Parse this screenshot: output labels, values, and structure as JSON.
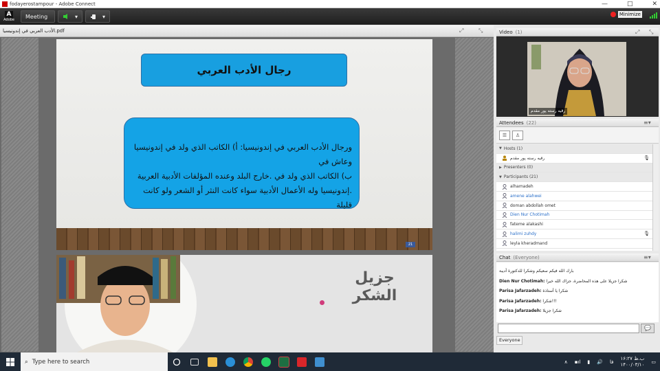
{
  "window": {
    "title": "fodayerostampour - Adobe Connect",
    "controls": [
      "—",
      "□",
      "✕"
    ]
  },
  "toolbar": {
    "logo_text": "Adobe",
    "meeting_label": "Meeting",
    "record_label": "Minimize"
  },
  "share_pod": {
    "file_name": "الأدب العربي في إندونيسيا.pdf",
    "slide1": {
      "title": "رجال الأدب العربي",
      "body_lines": [
        "ورجال الأدب العربي في إندونيسيا: أ) الكاتب الذي ولد في إندونيسيا وعاش في",
        "ب) الكاتب الذي ولد في .خارج البلد وعنده المؤلفات الأدبية العربية",
        ".إندونيسيا وله الأعمال الأدبية سواء كانت النثر أو الشعر ولو كانت قليلة"
      ],
      "page_badge": "21"
    },
    "slide2": {
      "thanks_line1": "جزيل",
      "thanks_line2": "الشكر"
    }
  },
  "video_pod": {
    "title": "Video",
    "count": "(1)",
    "speaker_name": "رقیه رسته پور مقدم"
  },
  "attendees_pod": {
    "title": "Attendees",
    "count": "(22)",
    "groups": {
      "hosts": "Hosts (1)",
      "presenters": "Presenters (0)",
      "participants": "Participants (21)"
    },
    "host_name": "رقیه رسته پور مقدم",
    "participants": [
      {
        "name": "alhamadeh",
        "blue": false,
        "mic": false
      },
      {
        "name": "amene alahwei",
        "blue": true,
        "mic": false
      },
      {
        "name": "doman abdollah omet",
        "blue": false,
        "mic": false
      },
      {
        "name": "Dien Nur Chotimah",
        "blue": true,
        "mic": false
      },
      {
        "name": "fateme alakashi",
        "blue": false,
        "mic": false
      },
      {
        "name": "halimi zuhdy",
        "blue": true,
        "mic": true
      },
      {
        "name": "leyla kheradmand",
        "blue": false,
        "mic": false
      }
    ]
  },
  "chat_pod": {
    "title": "Chat",
    "subtitle": "(Everyone)",
    "messages": [
      {
        "sender": "",
        "text": "بارك الله فيكم سعيكم وشكرا للدكتورة أديبة"
      },
      {
        "sender": "Dien Nur Chotimah:",
        "text": "شكرا جزيلا على هذه المحاضرة، جزاك الله خيرا"
      },
      {
        "sender": "Parisa Jafarzadeh:",
        "text": "شكرا يا أستاذة"
      },
      {
        "sender": "Parisa Jafarzadeh:",
        "text": "!!!شكرا"
      },
      {
        "sender": "Parisa Jafarzadeh:",
        "text": "شكرا جزيلا"
      }
    ],
    "send_icon": "💬",
    "recipient": "Everyone"
  },
  "taskbar": {
    "search_placeholder": "Type here to search",
    "time": "۱۶:۲۷ ب.ظ",
    "date": "۱۴۰۰/۰۳/۱۰",
    "lang": "فا"
  }
}
